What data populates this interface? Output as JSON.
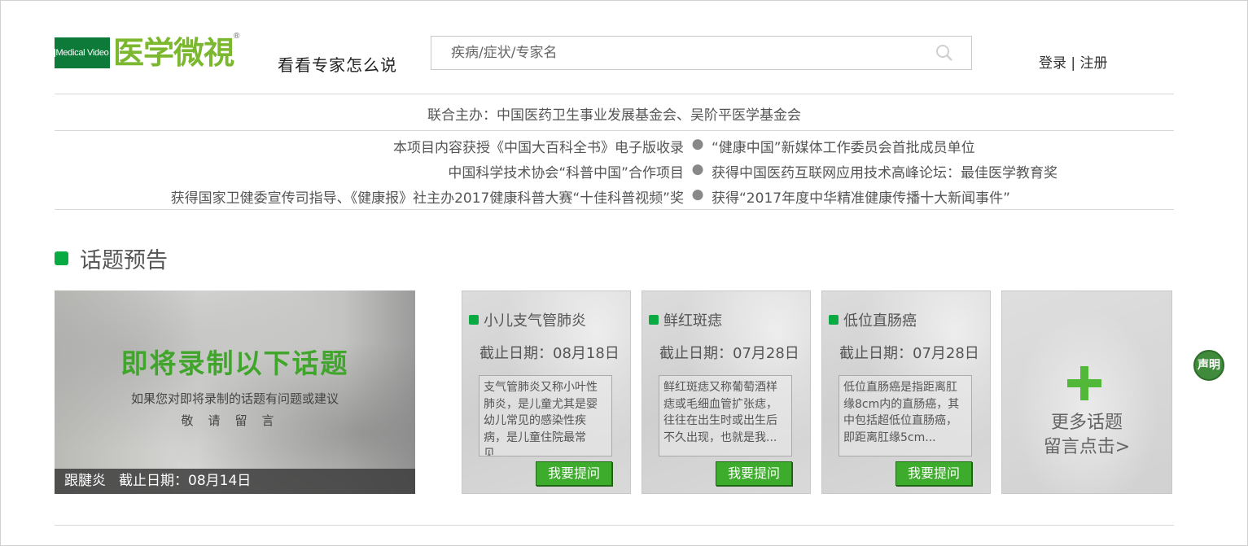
{
  "header": {
    "logo_en": "Medical Video",
    "logo_cn": "医学微視",
    "logo_reg": "®",
    "slogan": "看看专家怎么说",
    "search_placeholder": "疾病/症状/专家名",
    "login": "登录",
    "separator": " | ",
    "register": "注册"
  },
  "info": {
    "host": "联合主办：中国医药卫生事业发展基金会、吴阶平医学基金会",
    "honors": [
      {
        "left": "本项目内容获授《中国大百科全书》电子版收录",
        "right": "“健康中国”新媒体工作委员会首批成员单位"
      },
      {
        "left": "中国科学技术协会“科普中国”合作项目",
        "right": "获得中国医药互联网应用技术高峰论坛：最佳医学教育奖"
      },
      {
        "left": "获得国家卫健委宣传司指导、《健康报》社主办2017健康科普大赛“十佳科普视频”奖",
        "right": "获得“2017年度中华精准健康传播十大新闻事件”"
      }
    ],
    "dot": "●"
  },
  "section": {
    "title": "话题预告"
  },
  "banner": {
    "title": "即将录制以下话题",
    "sub": "如果您对即将录制的话题有问题或建议",
    "sub2": "敬请留言",
    "topic": "跟腱炎",
    "deadline": "截止日期：08月14日"
  },
  "cards": [
    {
      "title": "小儿支气管肺炎",
      "deadline": "截止日期：08月18日",
      "desc": "支气管肺炎又称小叶性肺炎，是儿童尤其是婴幼儿常见的感染性疾病，是儿童住院最常见...",
      "button": "我要提问"
    },
    {
      "title": "鲜红斑痣",
      "deadline": "截止日期：07月28日",
      "desc": "鲜红斑痣又称葡萄酒样痣或毛细血管扩张痣，往往在出生时或出生后不久出现，也就是我...",
      "button": "我要提问"
    },
    {
      "title": "低位直肠癌",
      "deadline": "截止日期：07月28日",
      "desc": "低位直肠癌是指距离肛缘8cm内的直肠癌，其中包括超低位直肠癌，即距离肛缘5cm...",
      "button": "我要提问"
    }
  ],
  "more": {
    "line1": "更多话题",
    "line2": "留言点击>"
  },
  "declare": "声明"
}
